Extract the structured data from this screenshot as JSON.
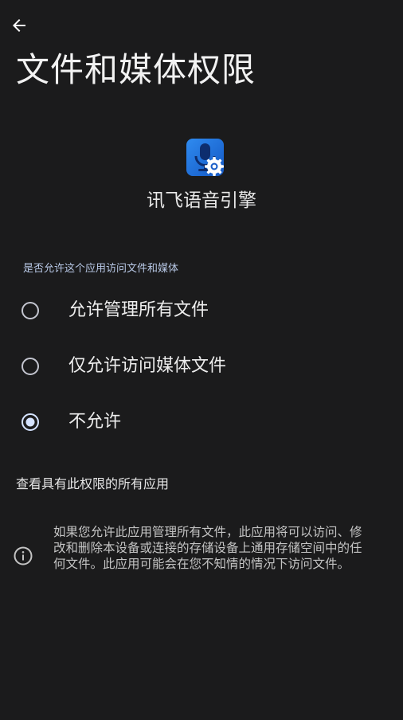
{
  "header": {
    "back_icon": "arrow-left-icon",
    "title": "文件和媒体权限"
  },
  "app": {
    "icon": "microphone-gear-icon",
    "name": "讯飞语音引擎",
    "icon_color": "#1f6fd6"
  },
  "permission": {
    "question": "是否允许这个应用访问文件和媒体",
    "options": [
      {
        "label": "允许管理所有文件",
        "selected": false
      },
      {
        "label": "仅允许访问媒体文件",
        "selected": false
      },
      {
        "label": "不允许",
        "selected": true
      }
    ]
  },
  "view_all_link": "查看具有此权限的所有应用",
  "info": {
    "icon": "info-icon",
    "text": "如果您允许此应用管理所有文件，此应用将可以访问、修改和删除本设备或连接的存储设备上通用存储空间中的任何文件。此应用可能会在您不知情的情况下访问文件。"
  },
  "colors": {
    "background": "#1b1b1c",
    "radio_selected": "#d5e3ff",
    "radio_unselected": "#c4c6d0",
    "question_text": "#b8c8e6"
  }
}
